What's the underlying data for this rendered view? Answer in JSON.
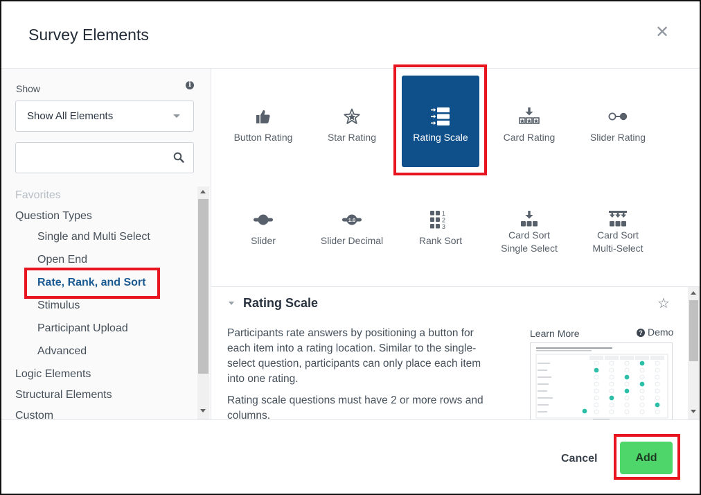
{
  "dialog": {
    "title": "Survey Elements"
  },
  "filter": {
    "show_label": "Show",
    "show_value": "Show All Elements",
    "search_placeholder": ""
  },
  "tree": {
    "favorites": "Favorites",
    "question_types": "Question Types",
    "single_multi": "Single and Multi Select",
    "open_end": "Open End",
    "rate_rank_sort": "Rate, Rank, and Sort",
    "stimulus": "Stimulus",
    "participant_upload": "Participant Upload",
    "advanced": "Advanced",
    "logic": "Logic Elements",
    "structural": "Structural Elements",
    "custom": "Custom"
  },
  "elements": [
    {
      "label": "Button Rating",
      "icon": "thumbs-up-icon"
    },
    {
      "label": "Star Rating",
      "icon": "star-icon"
    },
    {
      "label": "Rating Scale",
      "icon": "rating-scale-icon",
      "selected": true
    },
    {
      "label": "Card Rating",
      "icon": "card-rating-icon"
    },
    {
      "label": "Slider Rating",
      "icon": "slider-rating-icon"
    },
    {
      "label": "Slider",
      "icon": "slider-icon"
    },
    {
      "label": "Slider Decimal",
      "icon": "slider-decimal-icon"
    },
    {
      "label": "Rank Sort",
      "icon": "rank-sort-icon"
    },
    {
      "label_line1": "Card Sort",
      "label_line2": "Single Select",
      "icon": "card-sort-single-icon"
    },
    {
      "label_line1": "Card Sort",
      "label_line2": "Multi-Select",
      "icon": "card-sort-multi-icon"
    }
  ],
  "detail": {
    "title": "Rating Scale",
    "desc1": "Participants rate answers by positioning a button for each item into a rating location. Similar to the single-select question, participants can only place each item into one rating.",
    "desc2": "Rating scale questions must have 2 or more rows and columns.",
    "learn_more": "Learn More",
    "demo": "Demo"
  },
  "footer": {
    "cancel": "Cancel",
    "add": "Add"
  },
  "colors": {
    "selected_tile": "#0f4f8a",
    "add_button": "#4fd66a",
    "highlight": "#e8141f",
    "active_link": "#1a5a93"
  }
}
